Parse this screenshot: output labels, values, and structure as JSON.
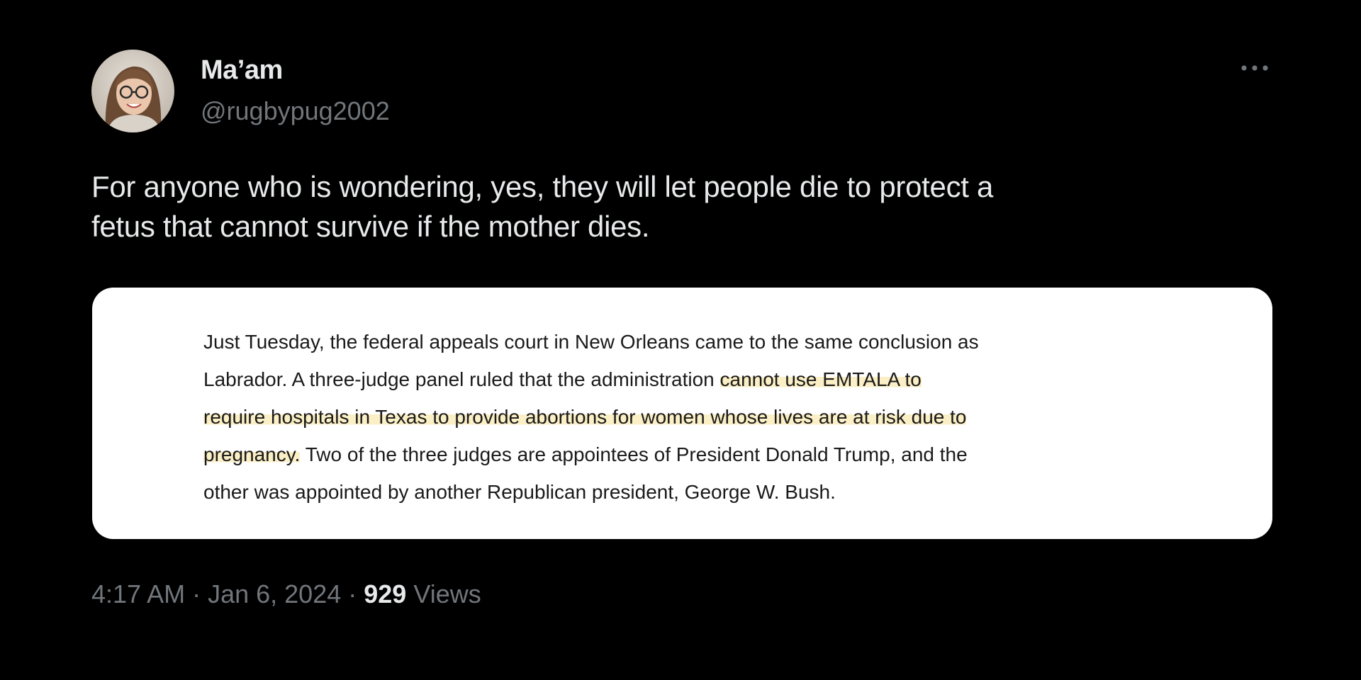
{
  "author": {
    "display_name": "Ma’am",
    "handle": "@rugbypug2002",
    "avatar_icon": "profile-photo"
  },
  "more_icon": "ellipsis-horizontal-icon",
  "tweet": {
    "text_lines": [
      "For anyone who is wondering, yes, they will let people die to protect a",
      "fetus that cannot survive if the mother dies."
    ]
  },
  "media": {
    "excerpt": {
      "line1": "Just Tuesday, the federal appeals court in New Orleans came to the same conclusion as",
      "line2_plain": "Labrador. A three-judge panel ruled that the administration ",
      "line2_highlight": "cannot use EMTALA to",
      "line3_highlight": "require hospitals in Texas to provide abortions for women whose lives are at risk due to",
      "line4_highlight": "pregnancy.",
      "line4_plain": " Two of the three judges are appointees of President Donald Trump, and the",
      "line5": "other was appointed by another Republican president, George W. Bush."
    },
    "highlight_color": "#fbefc6"
  },
  "meta": {
    "time": "4:17 AM",
    "separator": " · ",
    "date": "Jan 6, 2024",
    "views_count": "929",
    "views_label": " Views"
  },
  "colors": {
    "background": "#000000",
    "primary_text": "#e7e9ea",
    "secondary_text": "#71767b"
  }
}
